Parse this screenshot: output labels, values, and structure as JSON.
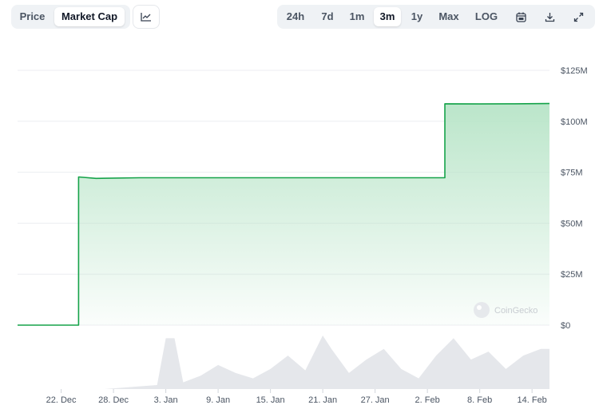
{
  "toolbar": {
    "view_tabs": [
      {
        "label": "Price",
        "active": false
      },
      {
        "label": "Market Cap",
        "active": true
      }
    ],
    "chart_type_icon": "line-chart-icon",
    "ranges": [
      {
        "label": "24h",
        "active": false
      },
      {
        "label": "7d",
        "active": false
      },
      {
        "label": "1m",
        "active": false
      },
      {
        "label": "3m",
        "active": true
      },
      {
        "label": "1y",
        "active": false
      },
      {
        "label": "Max",
        "active": false
      },
      {
        "label": "LOG",
        "active": false
      }
    ],
    "icons": [
      "calendar-icon",
      "download-icon",
      "expand-icon"
    ]
  },
  "watermark": "CoinGecko",
  "colors": {
    "line": "#16a34a",
    "area_top": "#b7e4c7",
    "volume": "#e5e7eb",
    "active_bg": "#ffffff",
    "segment_bg": "#eff2f5"
  },
  "chart_data": {
    "type": "area",
    "y_axis": {
      "ticks": [
        "$0",
        "$25M",
        "$50M",
        "$75M",
        "$100M",
        "$125M"
      ],
      "tick_values": [
        0,
        25,
        50,
        75,
        100,
        125
      ],
      "unit": "million USD",
      "position": "right",
      "range": [
        0,
        125
      ]
    },
    "x_axis": {
      "ticks": [
        "22. Dec",
        "28. Dec",
        "3. Jan",
        "9. Jan",
        "15. Jan",
        "21. Jan",
        "27. Jan",
        "2. Feb",
        "8. Feb",
        "14. Feb"
      ],
      "range": [
        "2024-12-17",
        "2025-02-16"
      ]
    },
    "series": [
      {
        "type": "line",
        "points": [
          [
            "2024-12-17",
            0
          ],
          [
            "2024-12-23",
            0
          ],
          [
            "2024-12-24",
            72.7
          ],
          [
            "2024-12-26",
            72
          ],
          [
            "2024-12-31",
            72.3
          ],
          [
            "2025-01-10",
            72.3
          ],
          [
            "2025-01-20",
            72.3
          ],
          [
            "2025-01-28",
            72.3
          ],
          [
            "2025-02-03",
            72.3
          ],
          [
            "2025-02-04",
            108.6
          ],
          [
            "2025-02-08",
            108.5
          ],
          [
            "2025-02-12",
            108.6
          ],
          [
            "2025-02-16",
            108.7
          ]
        ]
      },
      {
        "type": "volume",
        "points": [
          [
            "2024-12-17",
            0
          ],
          [
            "2024-12-27",
            0
          ],
          [
            "2024-12-31",
            2
          ],
          [
            "2025-01-02",
            3
          ],
          [
            "2025-01-03",
            38
          ],
          [
            "2025-01-04",
            38
          ],
          [
            "2025-01-05",
            5
          ],
          [
            "2025-01-07",
            10
          ],
          [
            "2025-01-09",
            18
          ],
          [
            "2025-01-11",
            12
          ],
          [
            "2025-01-13",
            8
          ],
          [
            "2025-01-15",
            15
          ],
          [
            "2025-01-17",
            25
          ],
          [
            "2025-01-19",
            14
          ],
          [
            "2025-01-21",
            40
          ],
          [
            "2025-01-22",
            30
          ],
          [
            "2025-01-24",
            12
          ],
          [
            "2025-01-26",
            22
          ],
          [
            "2025-01-28",
            30
          ],
          [
            "2025-01-30",
            15
          ],
          [
            "2025-02-01",
            8
          ],
          [
            "2025-02-03",
            25
          ],
          [
            "2025-02-05",
            38
          ],
          [
            "2025-02-07",
            22
          ],
          [
            "2025-02-09",
            28
          ],
          [
            "2025-02-11",
            15
          ],
          [
            "2025-02-13",
            25
          ],
          [
            "2025-02-15",
            30
          ],
          [
            "2025-02-16",
            30
          ]
        ]
      }
    ],
    "grid": true,
    "legend": "none"
  }
}
